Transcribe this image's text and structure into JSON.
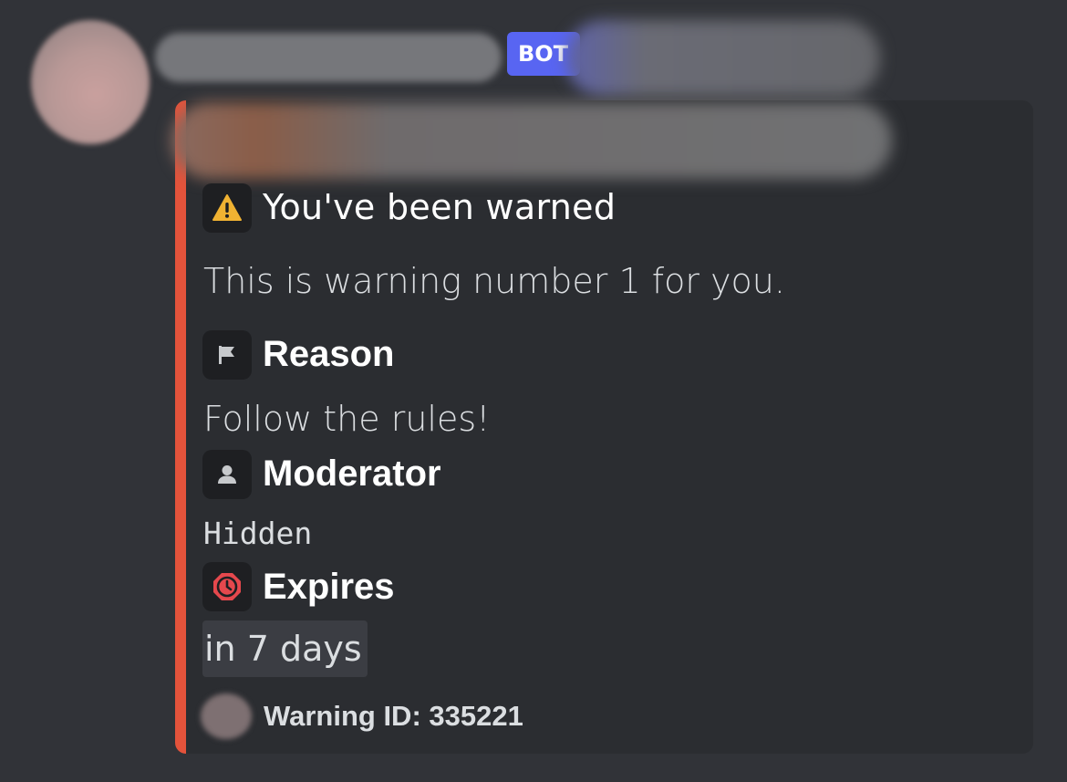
{
  "message": {
    "bot_tag": "BOT"
  },
  "embed": {
    "accent_color": "#e4533b",
    "title": "You've been warned",
    "description": "This is warning number 1 for you.",
    "fields": [
      {
        "icon": "flag-icon",
        "name": "Reason",
        "value": "Follow the rules!"
      },
      {
        "icon": "person-icon",
        "name": "Moderator",
        "value": "Hidden"
      },
      {
        "icon": "clock-icon",
        "name": "Expires",
        "value": "in 7 days"
      }
    ],
    "footer": "Warning ID: 335221"
  },
  "colors": {
    "background": "#313338",
    "embed_background": "#2b2d31",
    "bot_tag": "#5865f2",
    "warning": "#f0b232",
    "danger": "#e5484d"
  }
}
